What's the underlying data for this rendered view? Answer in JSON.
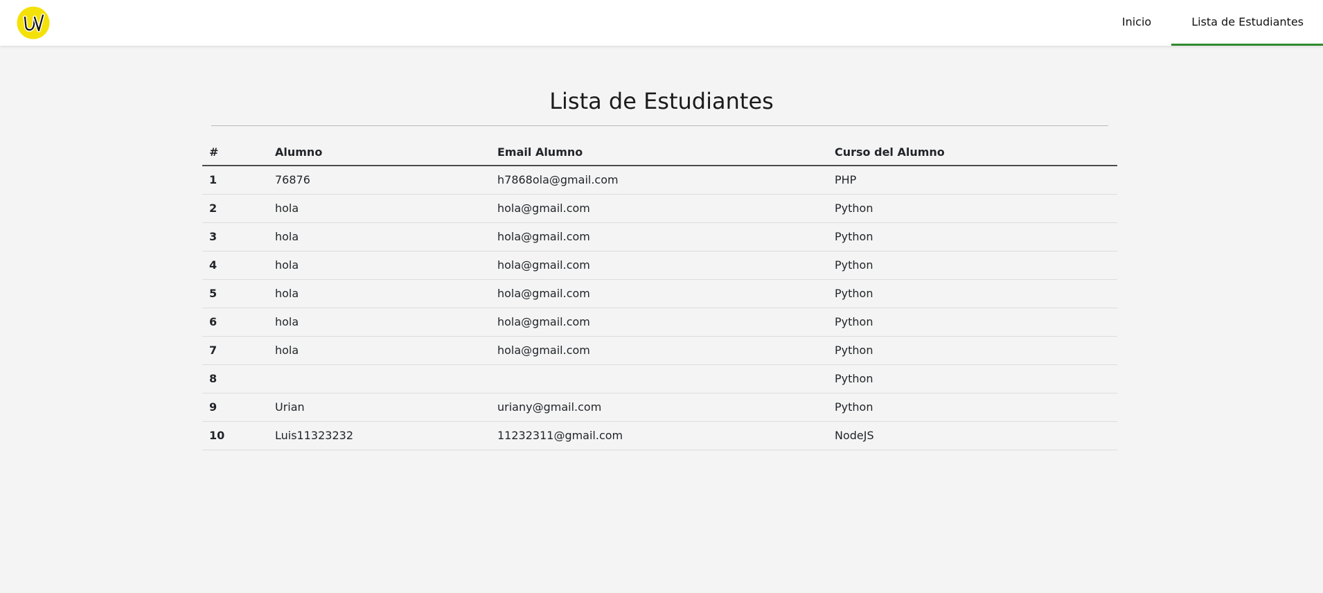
{
  "nav": {
    "logo_icon": "uv-logo-icon",
    "logo_text": "UV",
    "links": [
      {
        "label": "Inicio",
        "active": false
      },
      {
        "label": "Lista de Estudiantes",
        "active": true
      }
    ],
    "accent_color": "#2e8b2e"
  },
  "main": {
    "title": "Lista de Estudiantes",
    "table": {
      "headers": [
        "#",
        "Alumno",
        "Email Alumno",
        "Curso del Alumno"
      ],
      "rows": [
        [
          "1",
          "76876",
          "h7868ola@gmail.com",
          "PHP"
        ],
        [
          "2",
          "hola",
          "hola@gmail.com",
          "Python"
        ],
        [
          "3",
          "hola",
          "hola@gmail.com",
          "Python"
        ],
        [
          "4",
          "hola",
          "hola@gmail.com",
          "Python"
        ],
        [
          "5",
          "hola",
          "hola@gmail.com",
          "Python"
        ],
        [
          "6",
          "hola",
          "hola@gmail.com",
          "Python"
        ],
        [
          "7",
          "hola",
          "hola@gmail.com",
          "Python"
        ],
        [
          "8",
          "",
          "",
          "Python"
        ],
        [
          "9",
          "Urian",
          "uriany@gmail.com",
          "Python"
        ],
        [
          "10",
          "Luis11323232",
          "11232311@gmail.com",
          "NodeJS"
        ]
      ]
    }
  }
}
